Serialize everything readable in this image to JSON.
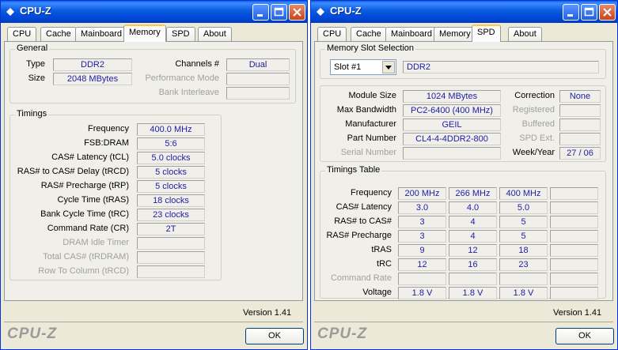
{
  "left_window": {
    "title": "CPU-Z",
    "tabs": [
      "CPU",
      "Cache",
      "Mainboard",
      "Memory",
      "SPD",
      "About"
    ],
    "active_tab": "Memory",
    "general": {
      "legend": "General",
      "type_label": "Type",
      "type_value": "DDR2",
      "size_label": "Size",
      "size_value": "2048 MBytes",
      "channels_label": "Channels #",
      "channels_value": "Dual",
      "perf_mode_label": "Performance Mode",
      "perf_mode_value": "",
      "bank_interleave_label": "Bank Interleave",
      "bank_interleave_value": ""
    },
    "timings": {
      "legend": "Timings",
      "rows": [
        {
          "label": "Frequency",
          "value": "400.0 MHz",
          "enabled": true
        },
        {
          "label": "FSB:DRAM",
          "value": "5:6",
          "enabled": true
        },
        {
          "label": "CAS# Latency (tCL)",
          "value": "5.0 clocks",
          "enabled": true
        },
        {
          "label": "RAS# to CAS# Delay (tRCD)",
          "value": "5 clocks",
          "enabled": true
        },
        {
          "label": "RAS# Precharge (tRP)",
          "value": "5 clocks",
          "enabled": true
        },
        {
          "label": "Cycle Time (tRAS)",
          "value": "18 clocks",
          "enabled": true
        },
        {
          "label": "Bank Cycle Time (tRC)",
          "value": "23 clocks",
          "enabled": true
        },
        {
          "label": "Command Rate (CR)",
          "value": "2T",
          "enabled": true
        },
        {
          "label": "DRAM Idle Timer",
          "value": "",
          "enabled": false
        },
        {
          "label": "Total CAS# (tRDRAM)",
          "value": "",
          "enabled": false
        },
        {
          "label": "Row To Column (tRCD)",
          "value": "",
          "enabled": false
        }
      ]
    },
    "version": "Version 1.41",
    "brand": "CPU-Z",
    "ok_label": "OK"
  },
  "right_window": {
    "title": "CPU-Z",
    "tabs": [
      "CPU",
      "Cache",
      "Mainboard",
      "Memory",
      "SPD",
      "About"
    ],
    "active_tab": "SPD",
    "slot_selection": {
      "legend": "Memory Slot Selection",
      "slot_value": "Slot #1",
      "type_value": "DDR2"
    },
    "module": {
      "module_size_label": "Module Size",
      "module_size_value": "1024 MBytes",
      "max_bandwidth_label": "Max Bandwidth",
      "max_bandwidth_value": "PC2-6400 (400 MHz)",
      "manufacturer_label": "Manufacturer",
      "manufacturer_value": "GEIL",
      "part_number_label": "Part Number",
      "part_number_value": "CL4-4-4DDR2-800",
      "serial_number_label": "Serial Number",
      "serial_number_value": "",
      "correction_label": "Correction",
      "correction_value": "None",
      "registered_label": "Registered",
      "registered_value": "",
      "buffered_label": "Buffered",
      "buffered_value": "",
      "spd_ext_label": "SPD Ext.",
      "spd_ext_value": "",
      "week_year_label": "Week/Year",
      "week_year_value": "27 / 06"
    },
    "timings_table": {
      "legend": "Timings Table",
      "rows": [
        {
          "label": "Frequency",
          "values": [
            "200 MHz",
            "266 MHz",
            "400 MHz",
            ""
          ],
          "enabled": true
        },
        {
          "label": "CAS# Latency",
          "values": [
            "3.0",
            "4.0",
            "5.0",
            ""
          ],
          "enabled": true
        },
        {
          "label": "RAS# to CAS#",
          "values": [
            "3",
            "4",
            "5",
            ""
          ],
          "enabled": true
        },
        {
          "label": "RAS# Precharge",
          "values": [
            "3",
            "4",
            "5",
            ""
          ],
          "enabled": true
        },
        {
          "label": "tRAS",
          "values": [
            "9",
            "12",
            "18",
            ""
          ],
          "enabled": true
        },
        {
          "label": "tRC",
          "values": [
            "12",
            "16",
            "23",
            ""
          ],
          "enabled": true
        },
        {
          "label": "Command Rate",
          "values": [
            "",
            "",
            "",
            ""
          ],
          "enabled": false
        },
        {
          "label": "Voltage",
          "values": [
            "1.8 V",
            "1.8 V",
            "1.8 V",
            ""
          ],
          "enabled": true
        }
      ]
    },
    "version": "Version 1.41",
    "brand": "CPU-Z",
    "ok_label": "OK"
  }
}
